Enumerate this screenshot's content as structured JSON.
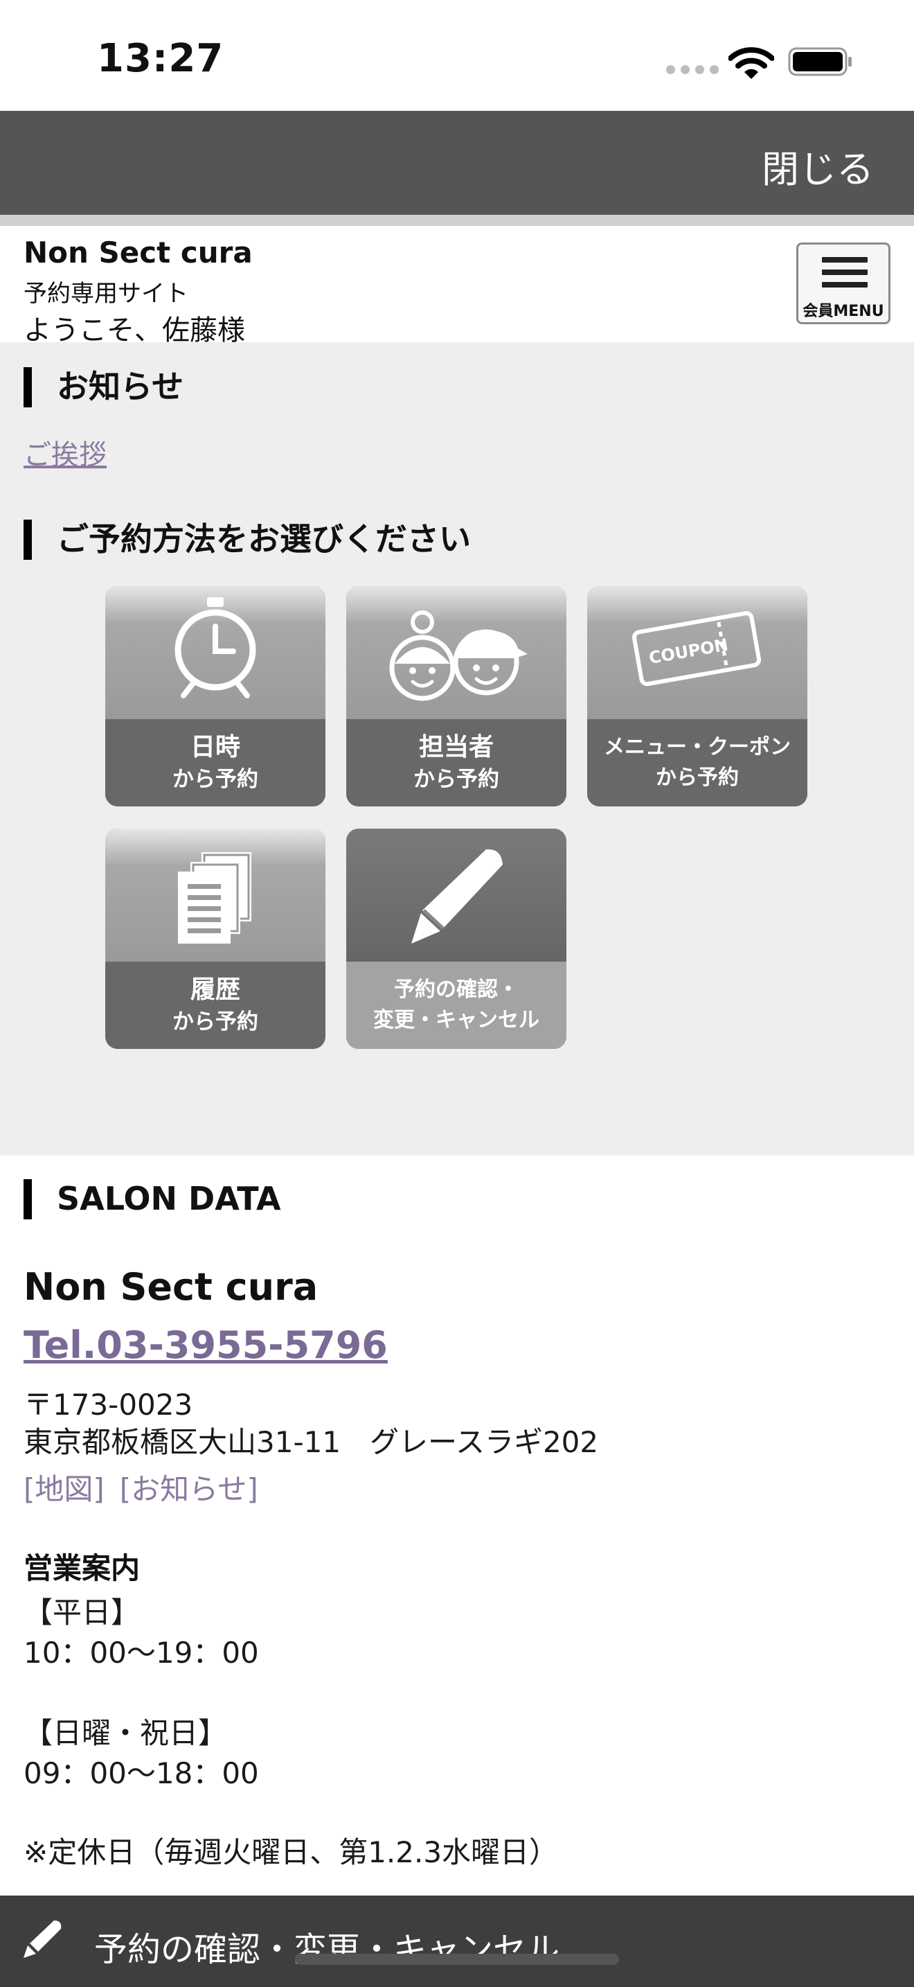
{
  "status_bar": {
    "time": "13:27"
  },
  "header": {
    "close_label": "閉じる"
  },
  "site": {
    "name": "Non Sect cura",
    "subtitle": "予約専用サイト",
    "welcome": "ようこそ、佐藤様",
    "member_menu_label": "会員MENU"
  },
  "notice": {
    "heading": "お知らせ",
    "link": "ご挨拶"
  },
  "reserve": {
    "heading": "ご予約方法をお選びください",
    "tiles": [
      {
        "line1": "日時",
        "line2": "から予約",
        "icon": "alarm-clock-icon"
      },
      {
        "line1": "担当者",
        "line2": "から予約",
        "icon": "staff-faces-icon"
      },
      {
        "line1": "メニュー・クーポン",
        "line2": "から予約",
        "icon": "coupon-icon",
        "icon_text": "COUPON"
      },
      {
        "line1": "履歴",
        "line2": "から予約",
        "icon": "documents-icon"
      },
      {
        "line1": "予約の確認・",
        "line2": "変更・キャンセル",
        "icon": "pencil-icon"
      }
    ]
  },
  "salon": {
    "heading": "SALON DATA",
    "name": "Non Sect cura",
    "tel": "Tel.03-3955-5796",
    "postal": "〒173-0023",
    "address": "東京都板橋区大山31-11　グレースラギ202",
    "links": [
      "[地図]",
      "[お知らせ]"
    ],
    "hours_heading": "営業案内",
    "weekday_label": "【平日】",
    "weekday_hours": "10：00〜19：00",
    "holiday_label": "【日曜・祝日】",
    "holiday_hours": "09：00〜18：00",
    "closed_note": "※定休日（毎週火曜日、第1.2.3水曜日）"
  },
  "bottom_bar": {
    "label": "予約の確認・変更・キャンセル"
  }
}
